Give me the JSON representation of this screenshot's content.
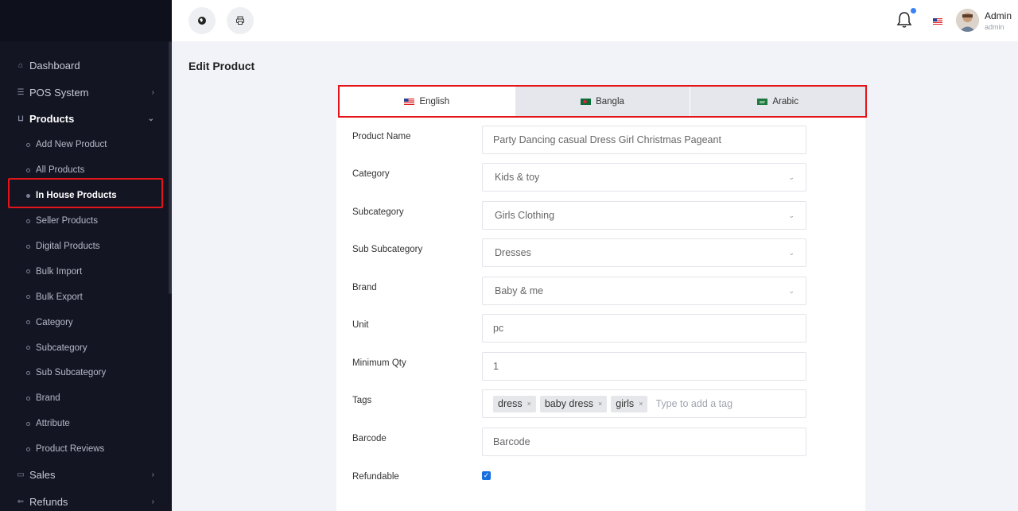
{
  "sidebar": {
    "items": [
      {
        "label": "Dashboard",
        "icon": "home-icon"
      },
      {
        "label": "POS System",
        "icon": "list-icon"
      },
      {
        "label": "Products",
        "icon": "cart-icon"
      }
    ],
    "products_sub": [
      "Add New Product",
      "All Products",
      "In House Products",
      "Seller Products",
      "Digital Products",
      "Bulk Import",
      "Bulk Export",
      "Category",
      "Subcategory",
      "Sub Subcategory",
      "Brand",
      "Attribute",
      "Product Reviews"
    ],
    "bottom_items": [
      {
        "label": "Sales",
        "icon": "wallet-icon"
      },
      {
        "label": "Refunds",
        "icon": "refund-icon"
      }
    ]
  },
  "header": {
    "admin_name": "Admin",
    "admin_role": "admin"
  },
  "page": {
    "title": "Edit Product"
  },
  "languages": {
    "tabs": [
      "English",
      "Bangla",
      "Arabic"
    ],
    "active": "English"
  },
  "form": {
    "product_name_label": "Product Name",
    "product_name_value": "Party Dancing casual Dress Girl Christmas Pageant",
    "category_label": "Category",
    "category_value": "Kids & toy",
    "subcategory_label": "Subcategory",
    "subcategory_value": "Girls Clothing",
    "subsubcategory_label": "Sub Subcategory",
    "subsubcategory_value": "Dresses",
    "brand_label": "Brand",
    "brand_value": "Baby & me",
    "unit_label": "Unit",
    "unit_value": "pc",
    "min_qty_label": "Minimum Qty",
    "min_qty_value": "1",
    "tags_label": "Tags",
    "tags": [
      "dress",
      "baby dress",
      "girls"
    ],
    "tags_placeholder": "Type to add a tag",
    "barcode_label": "Barcode",
    "barcode_placeholder": "Barcode",
    "refundable_label": "Refundable",
    "refundable_checked": true
  },
  "colors": {
    "sidebar_bg": "#131523",
    "highlight": "#e3151a",
    "checkbox": "#1a6fe0"
  }
}
